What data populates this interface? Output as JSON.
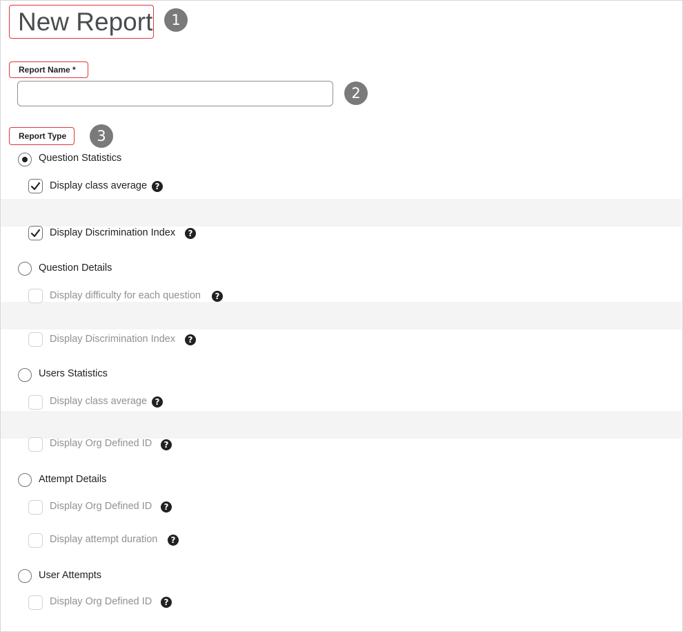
{
  "page": {
    "title": "New Report"
  },
  "callouts": {
    "one": "1",
    "two": "2",
    "three": "3"
  },
  "report_name": {
    "label": "Report Name *",
    "value": "",
    "placeholder": ""
  },
  "report_type": {
    "label": "Report Type",
    "options": [
      {
        "label": "Question Statistics",
        "selected": true,
        "checkboxes": [
          {
            "label": "Display class average",
            "checked": true,
            "enabled": true
          },
          {
            "label": "Display Discrimination Index",
            "checked": true,
            "enabled": true
          }
        ]
      },
      {
        "label": "Question Details",
        "selected": false,
        "checkboxes": [
          {
            "label": "Display difficulty for each question",
            "checked": false,
            "enabled": false
          },
          {
            "label": "Display Discrimination Index",
            "checked": false,
            "enabled": false
          }
        ]
      },
      {
        "label": "Users Statistics",
        "selected": false,
        "checkboxes": [
          {
            "label": "Display class average",
            "checked": false,
            "enabled": false
          },
          {
            "label": "Display Org Defined ID",
            "checked": false,
            "enabled": false
          }
        ]
      },
      {
        "label": "Attempt Details",
        "selected": false,
        "checkboxes": [
          {
            "label": "Display Org Defined ID",
            "checked": false,
            "enabled": false
          },
          {
            "label": "Display attempt duration",
            "checked": false,
            "enabled": false
          }
        ]
      },
      {
        "label": "User Attempts",
        "selected": false,
        "checkboxes": [
          {
            "label": "Display Org Defined ID",
            "checked": false,
            "enabled": false
          }
        ]
      }
    ]
  },
  "help_icon_glyph": "?",
  "colors": {
    "callout_border": "#e0353b",
    "badge": "#7a7a7a",
    "text": "#202122",
    "disabled_text": "#8e9194"
  }
}
